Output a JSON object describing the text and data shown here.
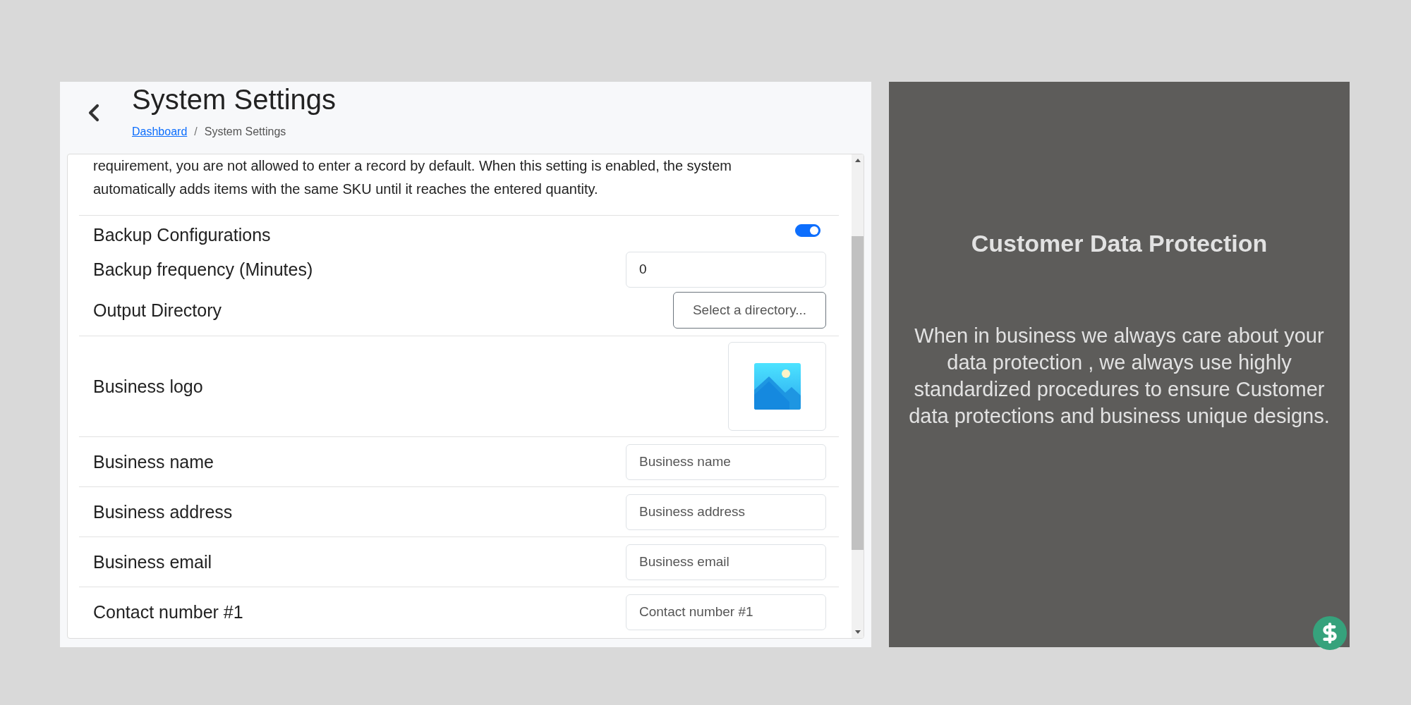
{
  "header": {
    "title": "System Settings",
    "breadcrumb": [
      {
        "label": "Dashboard",
        "kind": "link"
      },
      {
        "label": "System Settings",
        "kind": "current"
      }
    ],
    "breadcrumb_separator": "/"
  },
  "settings": {
    "description": "requirement, you are not allowed to enter a record by default. When this setting is enabled, the system automatically adds items with the same SKU until it reaches the entered quantity.",
    "groups": [
      {
        "rows": [
          {
            "kind": "toggle",
            "label": "Backup Configurations",
            "on": true
          },
          {
            "kind": "input",
            "label": "Backup frequency (Minutes)",
            "value": "0"
          },
          {
            "kind": "button",
            "label": "Output Directory",
            "button": "Select a directory..."
          }
        ]
      },
      {
        "rows": [
          {
            "kind": "image",
            "label": "Business logo"
          }
        ]
      },
      {
        "rows": [
          {
            "kind": "input",
            "label": "Business name",
            "placeholder": "Business name"
          }
        ]
      },
      {
        "rows": [
          {
            "kind": "input",
            "label": "Business address",
            "placeholder": "Business address"
          }
        ]
      },
      {
        "rows": [
          {
            "kind": "input",
            "label": "Business email",
            "placeholder": "Business email"
          }
        ]
      },
      {
        "rows": [
          {
            "kind": "input",
            "label": "Contact number #1",
            "placeholder": "Contact number #1"
          }
        ]
      }
    ]
  },
  "promo": {
    "title": "Customer Data Protection",
    "text": "When in business we always care about your data protection , we always use highly standardized procedures to ensure Customer data protections and business unique designs."
  }
}
